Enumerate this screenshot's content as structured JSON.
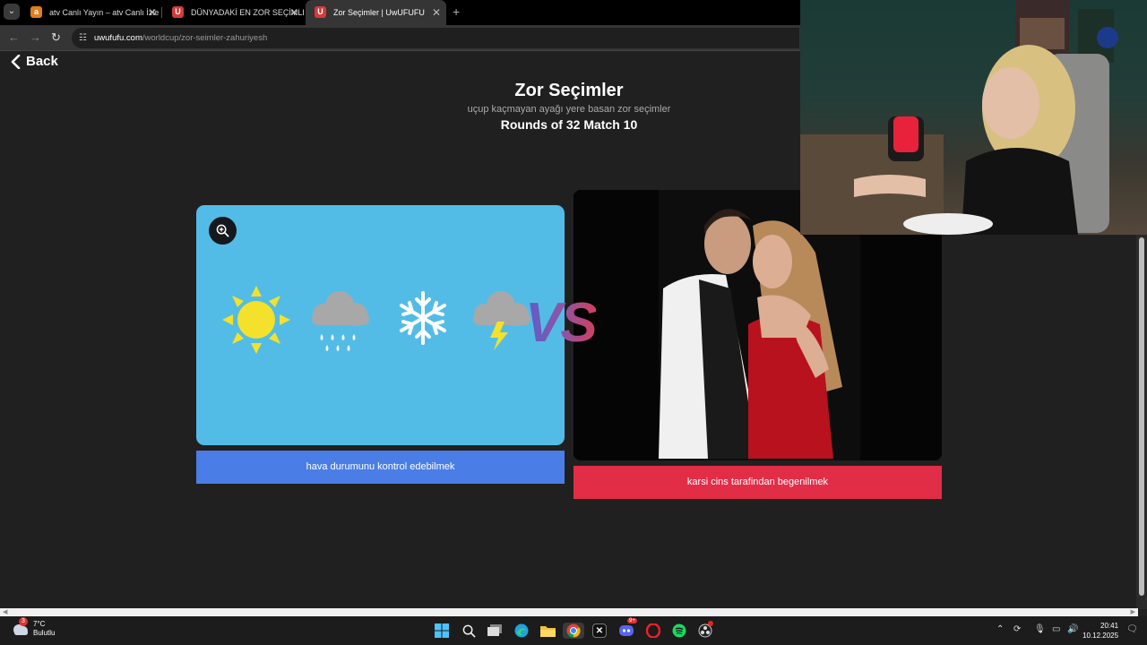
{
  "browser": {
    "tabs": [
      {
        "label": "atv Canlı Yayın – atv Canlı İzle -",
        "active": false,
        "favicon_color": "#e07f1a",
        "favicon": "a"
      },
      {
        "label": "DÜNYADAKİ EN ZOR SEÇİMLER",
        "active": false,
        "favicon_color": "#d43a3a",
        "favicon": "U"
      },
      {
        "label": "Zor Seçimler | UwUFUFU",
        "active": true,
        "favicon_color": "#d43a3a",
        "favicon": "U"
      }
    ],
    "new_tab": "+",
    "url_host": "uwufufu.com",
    "url_path": "/worldcup/zor-seimler-zahuriyesh"
  },
  "page": {
    "back_label": "Back",
    "title": "Zor Seçimler",
    "subtitle": "uçup kaçmayan ayağı yere basan zor seçimler",
    "round": "Rounds of 32 Match 10",
    "vs": "VS",
    "left_choice": {
      "label": "hava durumunu kontrol edebilmek",
      "image_icons": [
        "sun-icon",
        "rain-cloud-icon",
        "snowflake-icon",
        "storm-cloud-icon"
      ],
      "bg_color": "#53bce6",
      "button_color": "#4a7ee6"
    },
    "right_choice": {
      "label": "karsi cins tarafindan begenilmek",
      "button_color": "#e22d46"
    }
  },
  "taskbar": {
    "weather_temp": "7°C",
    "weather_desc": "Bulutlu",
    "weather_badge": "3",
    "clock_time": "20:41",
    "clock_date": "10.12.2025",
    "discord_badge": "9+",
    "apps": [
      "start-icon",
      "search-icon",
      "task-view-icon",
      "edge-icon",
      "file-explorer-icon",
      "chrome-icon",
      "x-app-icon",
      "discord-icon",
      "opera-icon",
      "spotify-icon",
      "obs-icon"
    ]
  }
}
